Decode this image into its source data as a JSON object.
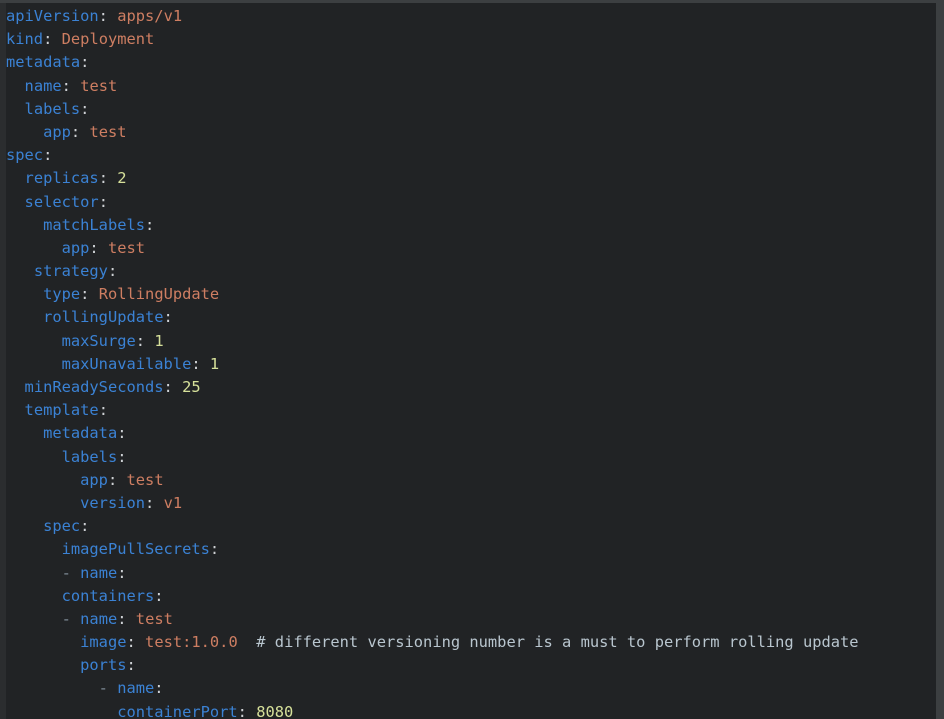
{
  "editor": {
    "language": "yaml",
    "filename_semantics": "kubernetes-deployment-manifest",
    "colors": {
      "background": "#212325",
      "gutter": "#2b2d2f",
      "chrome": "#3c3f41",
      "key": "#3b82d4",
      "value_string": "#ce7e62",
      "value_number": "#d6e09a",
      "punctuation": "#cfd2d6",
      "comment": "#b9c6cf",
      "list_dash": "#7f8b96"
    }
  },
  "lines": [
    {
      "indent": "",
      "tokens": [
        {
          "t": "key",
          "v": "apiVersion"
        },
        {
          "t": "punct",
          "v": ":"
        },
        {
          "t": "plain",
          "v": " "
        },
        {
          "t": "value",
          "v": "apps/v1"
        }
      ]
    },
    {
      "indent": "",
      "tokens": [
        {
          "t": "key",
          "v": "kind"
        },
        {
          "t": "punct",
          "v": ":"
        },
        {
          "t": "plain",
          "v": " "
        },
        {
          "t": "value",
          "v": "Deployment"
        }
      ]
    },
    {
      "indent": "",
      "tokens": [
        {
          "t": "key",
          "v": "metadata"
        },
        {
          "t": "punct",
          "v": ":"
        }
      ]
    },
    {
      "indent": "  ",
      "tokens": [
        {
          "t": "key",
          "v": "name"
        },
        {
          "t": "punct",
          "v": ":"
        },
        {
          "t": "plain",
          "v": " "
        },
        {
          "t": "value",
          "v": "test"
        }
      ]
    },
    {
      "indent": "  ",
      "tokens": [
        {
          "t": "key",
          "v": "labels"
        },
        {
          "t": "punct",
          "v": ":"
        }
      ]
    },
    {
      "indent": "    ",
      "tokens": [
        {
          "t": "key",
          "v": "app"
        },
        {
          "t": "punct",
          "v": ":"
        },
        {
          "t": "plain",
          "v": " "
        },
        {
          "t": "value",
          "v": "test"
        }
      ]
    },
    {
      "indent": "",
      "tokens": [
        {
          "t": "key",
          "v": "spec"
        },
        {
          "t": "punct",
          "v": ":"
        }
      ]
    },
    {
      "indent": "  ",
      "tokens": [
        {
          "t": "key",
          "v": "replicas"
        },
        {
          "t": "punct",
          "v": ":"
        },
        {
          "t": "plain",
          "v": " "
        },
        {
          "t": "number",
          "v": "2"
        }
      ]
    },
    {
      "indent": "  ",
      "tokens": [
        {
          "t": "key",
          "v": "selector"
        },
        {
          "t": "punct",
          "v": ":"
        }
      ]
    },
    {
      "indent": "    ",
      "tokens": [
        {
          "t": "key",
          "v": "matchLabels"
        },
        {
          "t": "punct",
          "v": ":"
        }
      ]
    },
    {
      "indent": "      ",
      "tokens": [
        {
          "t": "key",
          "v": "app"
        },
        {
          "t": "punct",
          "v": ":"
        },
        {
          "t": "plain",
          "v": " "
        },
        {
          "t": "value",
          "v": "test"
        }
      ]
    },
    {
      "indent": "   ",
      "tokens": [
        {
          "t": "key",
          "v": "strategy"
        },
        {
          "t": "punct",
          "v": ":"
        }
      ]
    },
    {
      "indent": "    ",
      "tokens": [
        {
          "t": "key",
          "v": "type"
        },
        {
          "t": "punct",
          "v": ":"
        },
        {
          "t": "plain",
          "v": " "
        },
        {
          "t": "value",
          "v": "RollingUpdate"
        }
      ]
    },
    {
      "indent": "    ",
      "tokens": [
        {
          "t": "key",
          "v": "rollingUpdate"
        },
        {
          "t": "punct",
          "v": ":"
        }
      ]
    },
    {
      "indent": "      ",
      "tokens": [
        {
          "t": "key",
          "v": "maxSurge"
        },
        {
          "t": "punct",
          "v": ":"
        },
        {
          "t": "plain",
          "v": " "
        },
        {
          "t": "number",
          "v": "1"
        }
      ]
    },
    {
      "indent": "      ",
      "tokens": [
        {
          "t": "key",
          "v": "maxUnavailable"
        },
        {
          "t": "punct",
          "v": ":"
        },
        {
          "t": "plain",
          "v": " "
        },
        {
          "t": "number",
          "v": "1"
        }
      ]
    },
    {
      "indent": "  ",
      "tokens": [
        {
          "t": "key",
          "v": "minReadySeconds"
        },
        {
          "t": "punct",
          "v": ":"
        },
        {
          "t": "plain",
          "v": " "
        },
        {
          "t": "number",
          "v": "25"
        }
      ]
    },
    {
      "indent": "  ",
      "tokens": [
        {
          "t": "key",
          "v": "template"
        },
        {
          "t": "punct",
          "v": ":"
        }
      ]
    },
    {
      "indent": "    ",
      "tokens": [
        {
          "t": "key",
          "v": "metadata"
        },
        {
          "t": "punct",
          "v": ":"
        }
      ]
    },
    {
      "indent": "      ",
      "tokens": [
        {
          "t": "key",
          "v": "labels"
        },
        {
          "t": "punct",
          "v": ":"
        }
      ]
    },
    {
      "indent": "        ",
      "tokens": [
        {
          "t": "key",
          "v": "app"
        },
        {
          "t": "punct",
          "v": ":"
        },
        {
          "t": "plain",
          "v": " "
        },
        {
          "t": "value",
          "v": "test"
        }
      ]
    },
    {
      "indent": "        ",
      "tokens": [
        {
          "t": "key",
          "v": "version"
        },
        {
          "t": "punct",
          "v": ":"
        },
        {
          "t": "plain",
          "v": " "
        },
        {
          "t": "value",
          "v": "v1"
        }
      ]
    },
    {
      "indent": "    ",
      "tokens": [
        {
          "t": "key",
          "v": "spec"
        },
        {
          "t": "punct",
          "v": ":"
        }
      ]
    },
    {
      "indent": "      ",
      "tokens": [
        {
          "t": "key",
          "v": "imagePullSecrets"
        },
        {
          "t": "punct",
          "v": ":"
        }
      ]
    },
    {
      "indent": "      ",
      "tokens": [
        {
          "t": "dash",
          "v": "- "
        },
        {
          "t": "key",
          "v": "name"
        },
        {
          "t": "punct",
          "v": ":"
        }
      ]
    },
    {
      "indent": "      ",
      "tokens": [
        {
          "t": "key",
          "v": "containers"
        },
        {
          "t": "punct",
          "v": ":"
        }
      ]
    },
    {
      "indent": "      ",
      "tokens": [
        {
          "t": "dash",
          "v": "- "
        },
        {
          "t": "key",
          "v": "name"
        },
        {
          "t": "punct",
          "v": ":"
        },
        {
          "t": "plain",
          "v": " "
        },
        {
          "t": "value",
          "v": "test"
        }
      ]
    },
    {
      "indent": "        ",
      "tokens": [
        {
          "t": "key",
          "v": "image"
        },
        {
          "t": "punct",
          "v": ":"
        },
        {
          "t": "plain",
          "v": " "
        },
        {
          "t": "value",
          "v": "test:1.0.0"
        },
        {
          "t": "plain",
          "v": "  "
        },
        {
          "t": "comment",
          "v": "# different versioning number is a must to perform rolling update"
        }
      ]
    },
    {
      "indent": "        ",
      "tokens": [
        {
          "t": "key",
          "v": "ports"
        },
        {
          "t": "punct",
          "v": ":"
        }
      ]
    },
    {
      "indent": "          ",
      "tokens": [
        {
          "t": "dash",
          "v": "- "
        },
        {
          "t": "key",
          "v": "name"
        },
        {
          "t": "punct",
          "v": ":"
        }
      ]
    },
    {
      "indent": "            ",
      "tokens": [
        {
          "t": "key",
          "v": "containerPort"
        },
        {
          "t": "punct",
          "v": ":"
        },
        {
          "t": "plain",
          "v": " "
        },
        {
          "t": "number",
          "v": "8080"
        }
      ]
    }
  ]
}
